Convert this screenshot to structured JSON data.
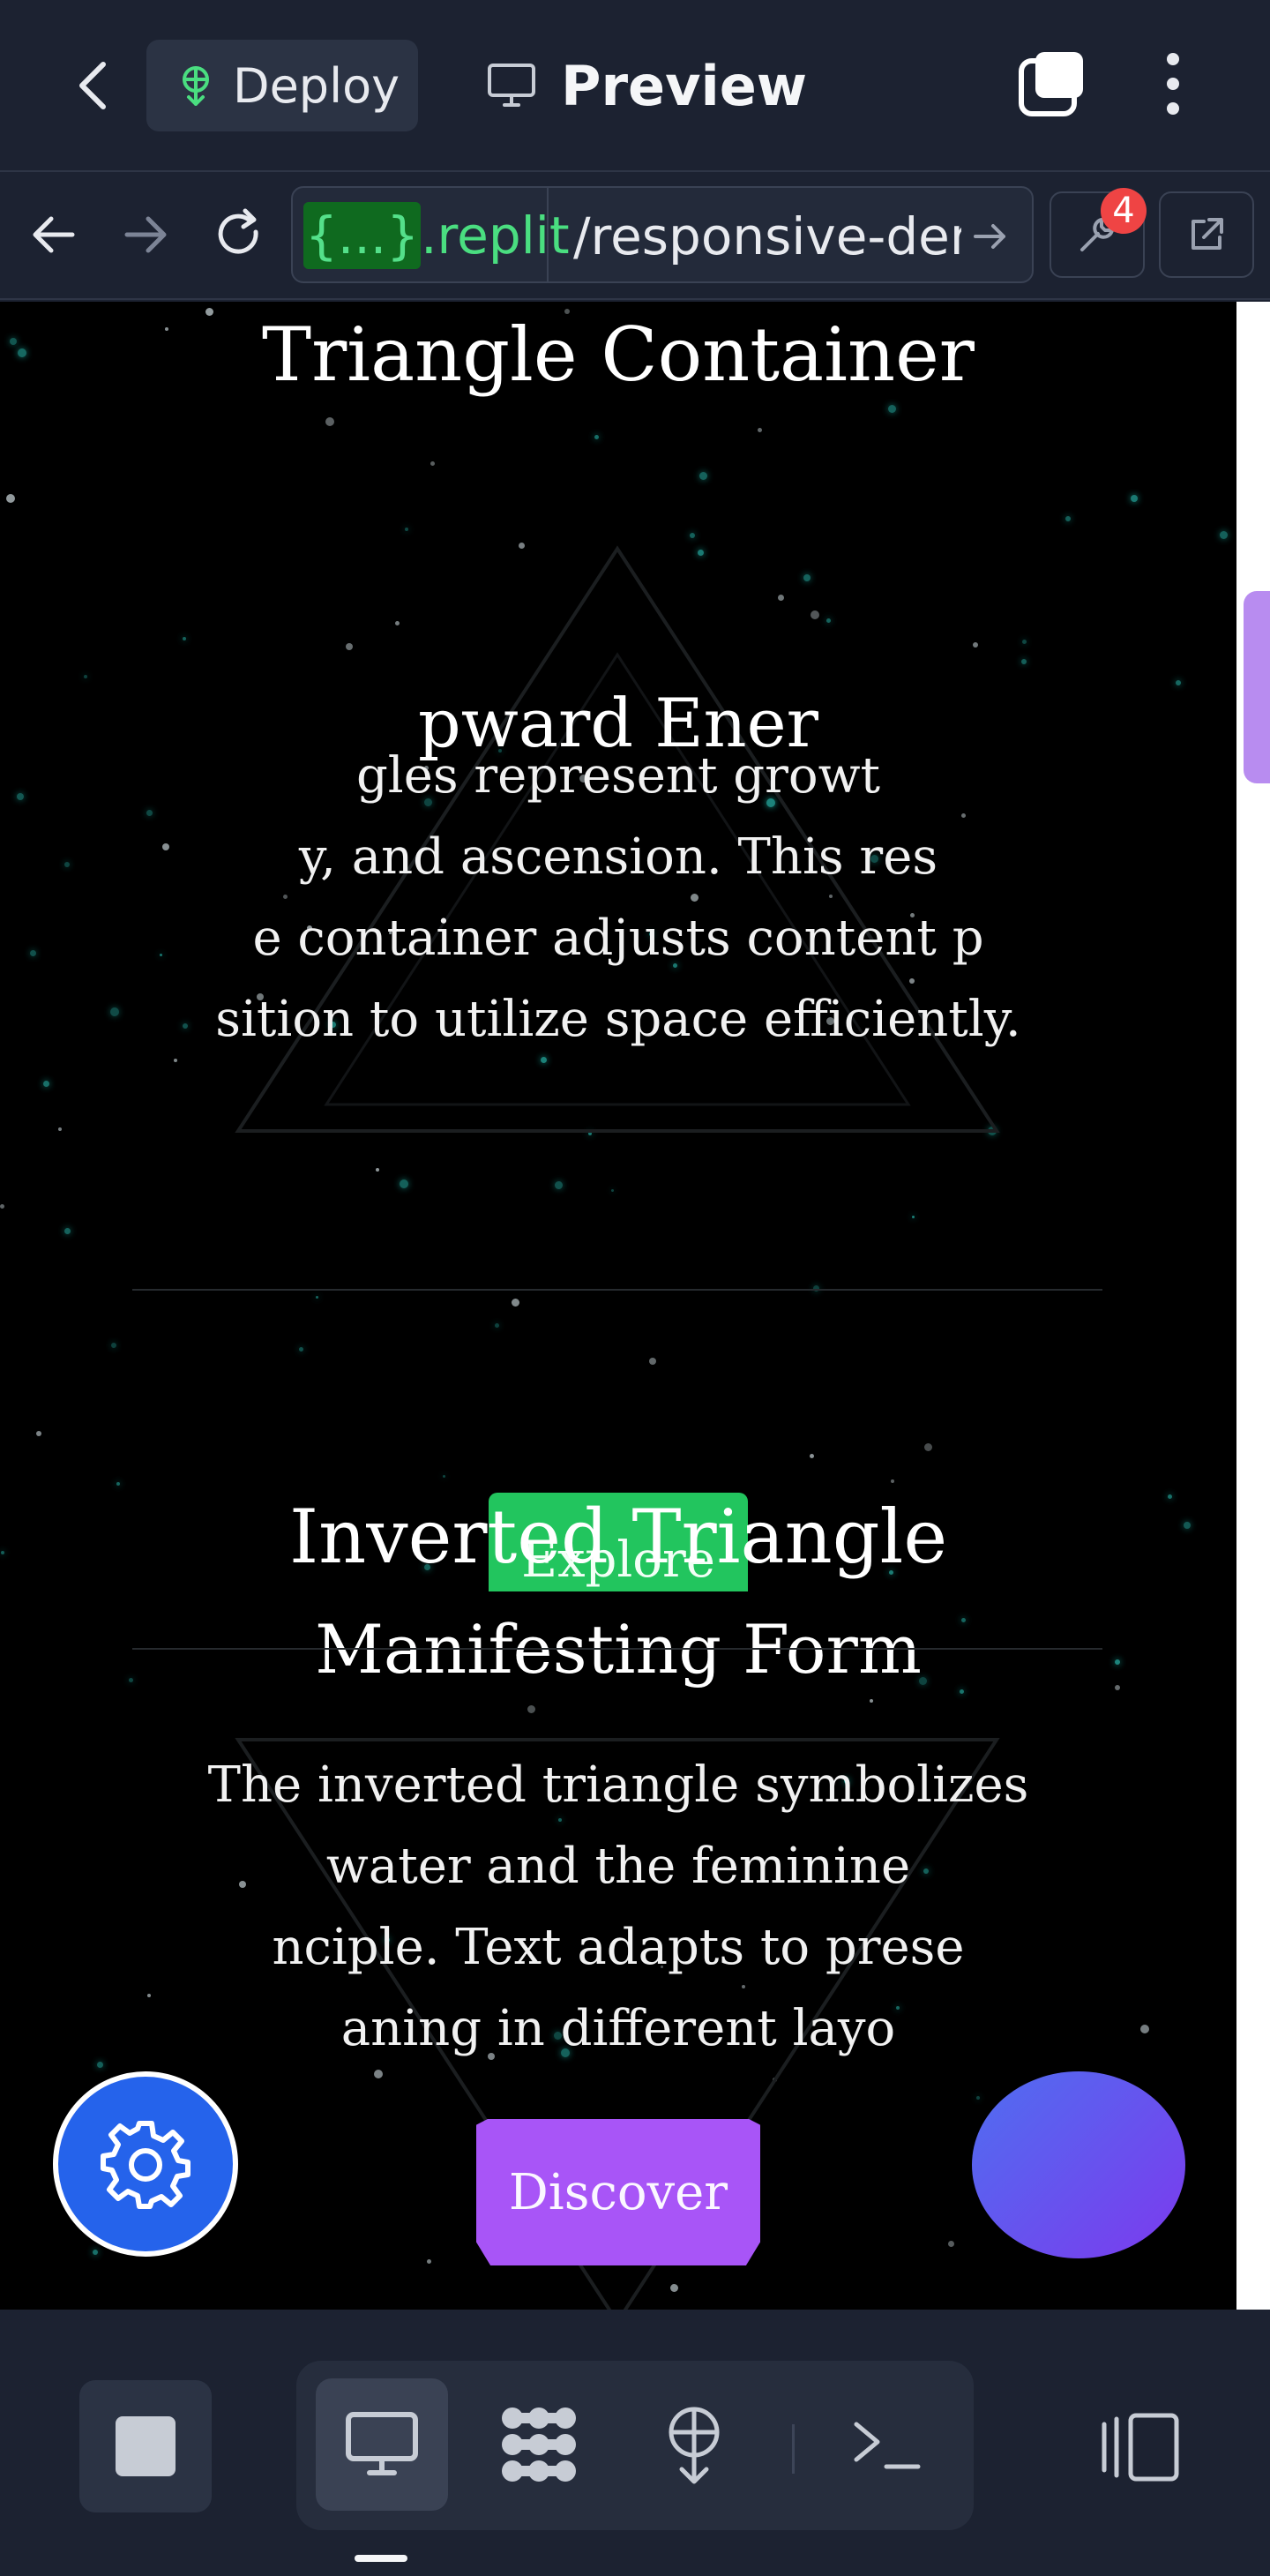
{
  "app_bar": {
    "deploy_label": "Deploy",
    "preview_label": "Preview"
  },
  "url_bar": {
    "host_highlight": "{...}",
    "host_suffix": ".replit",
    "path": "/responsive-dem",
    "devtools_badge": "4"
  },
  "page": {
    "section1_title": "Triangle Container",
    "card1_heading": "pward Ener",
    "card1_lines": [
      "gles represent growt",
      "y, and ascension. This res",
      "e container adjusts content p",
      "sition to utilize space efficiently."
    ],
    "card1_button": "Explore",
    "section2_title": "Inverted Triangle",
    "card2_heading": "Manifesting Form",
    "card2_lines": [
      "The inverted triangle symbolizes",
      "water and the feminine",
      "nciple. Text adapts to prese",
      "aning in different layo"
    ],
    "card2_button": "Discover"
  },
  "colors": {
    "chrome_bg": "#1c2231",
    "accent_green": "#22c55e",
    "accent_purple": "#a855f7",
    "settings_blue": "#2563eb",
    "badge_red": "#ef4444"
  },
  "icons": {
    "back": "chevron-left-icon",
    "deploy": "deploy-icon",
    "preview": "monitor-icon",
    "tabs": "tabs-icon",
    "menu": "kebab-menu-icon",
    "nav_back": "arrow-left-icon",
    "nav_forward": "arrow-right-icon",
    "reload": "reload-icon",
    "go": "arrow-right-icon",
    "devtools": "wrench-icon",
    "external": "external-link-icon",
    "settings": "gear-icon",
    "stop": "stop-icon",
    "webview": "monitor-icon",
    "workflows": "workflow-icon",
    "deploy_tool": "deploy-icon",
    "shell": "terminal-icon",
    "devices": "devices-icon"
  }
}
